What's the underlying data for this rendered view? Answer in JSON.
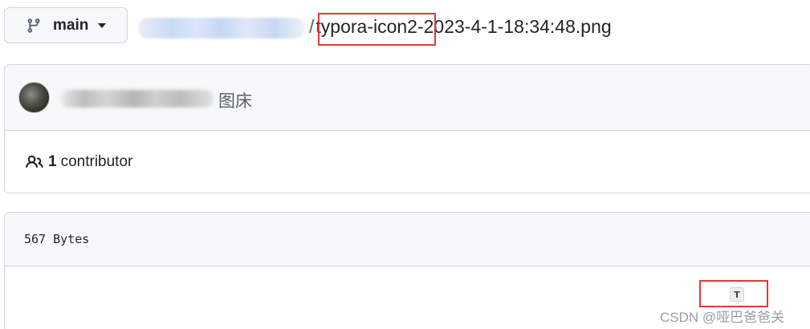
{
  "branch": {
    "label": "main",
    "icon": "git-branch-icon"
  },
  "breadcrumb": {
    "separator": "/",
    "filename_part1": "typora-icon2",
    "filename_part2": "-2023-4-1-18:34:48.png"
  },
  "commit": {
    "message": "图床"
  },
  "contributors": {
    "count": "1",
    "label": "contributor",
    "icon": "people-icon"
  },
  "file": {
    "size": "567 Bytes",
    "preview_glyph": "T"
  },
  "watermark": "CSDN @哑巴爸爸关",
  "colors": {
    "highlight": "#e03a3a",
    "border": "#d0d7de",
    "header_bg": "#f6f8fa"
  }
}
